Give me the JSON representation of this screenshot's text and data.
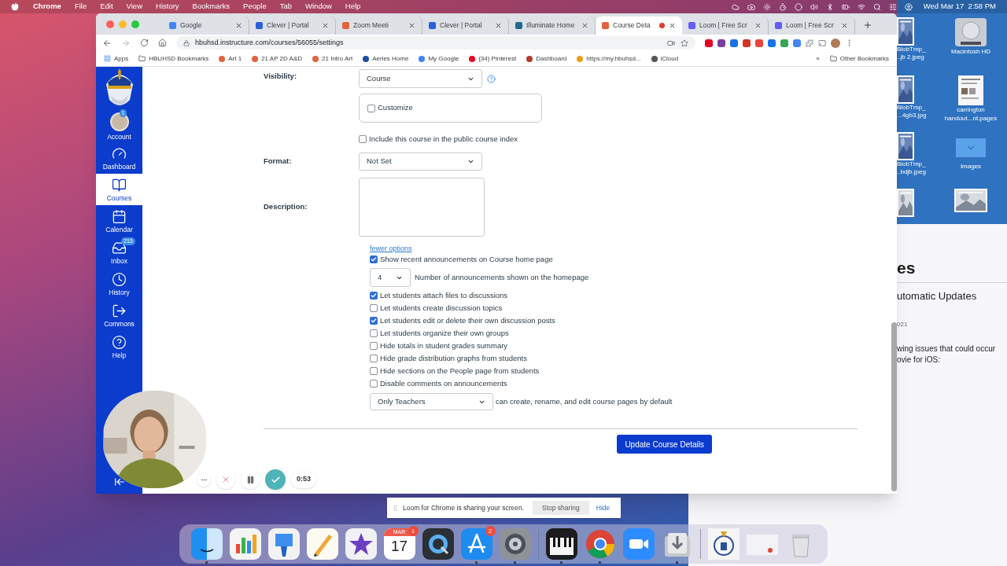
{
  "menubar": {
    "app": "Chrome",
    "menus": [
      "File",
      "Edit",
      "View",
      "History",
      "Bookmarks",
      "People",
      "Tab",
      "Window",
      "Help"
    ],
    "clock": "Wed Mar 17  2:58 PM"
  },
  "browser": {
    "tabs": [
      {
        "title": "Google",
        "selected": false,
        "recording": false,
        "color": "#4285f4"
      },
      {
        "title": "Clever | Portal",
        "selected": false,
        "recording": false,
        "color": "#2b5fd9"
      },
      {
        "title": "Zoom Meeti",
        "selected": false,
        "recording": false,
        "color": "#e0643c"
      },
      {
        "title": "Clever | Portal",
        "selected": false,
        "recording": false,
        "color": "#2b5fd9"
      },
      {
        "title": "Illuminate Home",
        "selected": false,
        "recording": false,
        "color": "#1f6b8f"
      },
      {
        "title": "Course Deta",
        "selected": true,
        "recording": true,
        "color": "#e0643c"
      },
      {
        "title": "Loom | Free Scr",
        "selected": false,
        "recording": false,
        "color": "#625df5"
      },
      {
        "title": "Loom | Free Scr",
        "selected": false,
        "recording": false,
        "color": "#625df5"
      }
    ],
    "url": "hbuhsd.instructure.com/courses/56055/settings",
    "bookmarks": [
      {
        "kind": "apps",
        "label": "Apps"
      },
      {
        "kind": "folder",
        "label": "HBUHSD Bookmarks"
      },
      {
        "kind": "site",
        "label": "Art 1",
        "color": "#e0643c"
      },
      {
        "kind": "site",
        "label": "21 AP 2D A&D",
        "color": "#e0643c"
      },
      {
        "kind": "site",
        "label": "21 Intro Art",
        "color": "#e0643c"
      },
      {
        "kind": "site",
        "label": "Aeries Home",
        "color": "#1b4fa0"
      },
      {
        "kind": "site",
        "label": "My Google",
        "color": "#4285f4"
      },
      {
        "kind": "site",
        "label": "(34) Pinterest",
        "color": "#e60023"
      },
      {
        "kind": "site",
        "label": "Dashboard",
        "color": "#b03a2e"
      },
      {
        "kind": "site",
        "label": "https://my.hbuhsd...",
        "color": "#e8a317"
      },
      {
        "kind": "site",
        "label": "iCloud",
        "color": "#555555"
      }
    ],
    "overflow": "»",
    "other_bookmarks": "Other Bookmarks"
  },
  "canvas": {
    "nav": [
      {
        "label": "Account",
        "selected": false,
        "badge": "1"
      },
      {
        "label": "Dashboard",
        "selected": false
      },
      {
        "label": "Courses",
        "selected": true
      },
      {
        "label": "Calendar",
        "selected": false
      },
      {
        "label": "Inbox",
        "selected": false,
        "badge": "213"
      },
      {
        "label": "History",
        "selected": false
      },
      {
        "label": "Commons",
        "selected": false
      },
      {
        "label": "Help",
        "selected": false
      }
    ],
    "form": {
      "visibility": {
        "label": "Visibility:",
        "value": "Course"
      },
      "customize": {
        "label": "Customize",
        "checked": false
      },
      "public_index": {
        "label": "Include this course in the public course index",
        "checked": false
      },
      "format": {
        "label": "Format:",
        "value": "Not Set"
      },
      "description": {
        "label": "Description:"
      },
      "more_link": "fewer options",
      "options": [
        {
          "kind": "checkbox",
          "label": "Show recent announcements on Course home page",
          "checked": true
        },
        {
          "kind": "count_select",
          "value": "4",
          "text": "Number of announcements shown on the homepage"
        },
        {
          "kind": "checkbox",
          "label": "Let students attach files to discussions",
          "checked": true
        },
        {
          "kind": "checkbox",
          "label": "Let students create discussion topics",
          "checked": false
        },
        {
          "kind": "checkbox",
          "label": "Let students edit or delete their own discussion posts",
          "checked": true
        },
        {
          "kind": "checkbox",
          "label": "Let students organize their own groups",
          "checked": false
        },
        {
          "kind": "checkbox",
          "label": "Hide totals in student grades summary",
          "checked": false
        },
        {
          "kind": "checkbox",
          "label": "Hide grade distribution graphs from students",
          "checked": false
        },
        {
          "kind": "checkbox",
          "label": "Hide sections on the People page from students",
          "checked": false
        },
        {
          "kind": "checkbox",
          "label": "Disable comments on announcements",
          "checked": false
        },
        {
          "kind": "role_select",
          "value": "Only Teachers",
          "text": "can create, rename, and edit course pages by default"
        }
      ],
      "submit": "Update Course Details"
    }
  },
  "loom": {
    "timer": "0:53",
    "banner": {
      "text": "Loom for Chrome is sharing your screen.",
      "stop": "Stop sharing",
      "hide": "Hide"
    }
  },
  "desktop": {
    "left_icons": [
      {
        "lines": [
          "BlobTmp_",
          "..jb 2.jpeg"
        ]
      },
      {
        "lines": [
          "BlobTmp_",
          "...4gb3.jpg"
        ]
      },
      {
        "lines": [
          "BlobTmp_",
          "..bdjb.jpeg"
        ]
      },
      {
        "kind": "picture"
      }
    ],
    "right_icons": [
      {
        "lines": [
          "Macintosh HD"
        ]
      },
      {
        "lines": [
          "carrington",
          "handout...nt.pages"
        ]
      },
      {
        "lines": [
          "Images"
        ]
      },
      {
        "kind": "picture"
      }
    ]
  },
  "back_window": {
    "heading": "es",
    "title": "utomatic Updates",
    "date": "021",
    "lines": [
      "wing issues that could occur",
      "ovie for iOS:"
    ]
  },
  "dock": {
    "groups": [
      [
        {
          "running": true
        },
        {
          "running": false
        },
        {
          "running": false
        },
        {
          "running": false
        },
        {
          "running": false
        },
        {
          "running": false,
          "month": "MAR",
          "day": "17",
          "badge": "1"
        },
        {
          "running": false
        },
        {
          "running": true,
          "badge": "2"
        },
        {
          "running": true
        }
      ],
      [
        {
          "running": true
        },
        {
          "running": true
        },
        {
          "running": false
        },
        {
          "running": true
        }
      ],
      [
        {
          "running": false
        },
        {
          "running": false
        },
        {
          "running": false
        }
      ]
    ]
  }
}
